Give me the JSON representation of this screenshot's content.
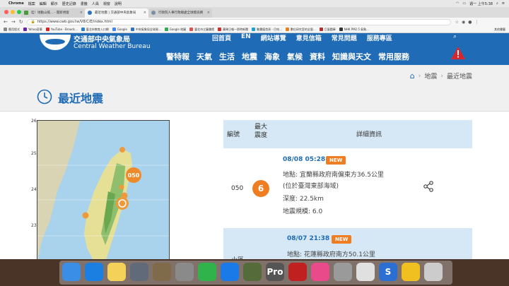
{
  "menubar": {
    "app": "Chrome",
    "menus": [
      "檔案",
      "編輯",
      "顯示",
      "歷史記錄",
      "書籤",
      "人員",
      "視窗",
      "說明"
    ],
    "clock": "週一 上午5:38"
  },
  "tabs": [
    {
      "label": "哇！地動山搖... - 開新視窗",
      "active": false,
      "color": "#4a9c3b"
    },
    {
      "label": "最近地震 | 交通部中央氣象局",
      "active": true,
      "color": "#2a74c2"
    },
    {
      "label": "行政院人事行政總處全球資訊網",
      "active": false,
      "color": "#7a8fa6"
    }
  ],
  "address": {
    "url": "https://www.cwb.gov.tw/V8/C/E/index.html"
  },
  "bookmarks": [
    {
      "label": "應用程式",
      "color": "#888888"
    },
    {
      "label": "Yahoo奇摩",
      "color": "#6a1fb0"
    },
    {
      "label": "YouTube - Broadc...",
      "color": "#e02020"
    },
    {
      "label": "臺北市教育入口網",
      "color": "#2a7fd1"
    },
    {
      "label": "Google",
      "color": "#4285f4"
    },
    {
      "label": "中央氣象局全球資...",
      "color": "#2a74c2"
    },
    {
      "label": "Google 地圖",
      "color": "#34a853"
    },
    {
      "label": "臺北市立圖書館",
      "color": "#d9534f"
    },
    {
      "label": "蘋果日報—即時新聞",
      "color": "#c9302c"
    },
    {
      "label": "動畫瘋首頁 - 巴哈...",
      "color": "#1ea1d9"
    },
    {
      "label": "數位研究室的全量...",
      "color": "#e67e22"
    },
    {
      "label": "巨蛋題庫",
      "color": "#b03030"
    },
    {
      "label": "NHK PM2.5 氣象...",
      "color": "#333333"
    }
  ],
  "bookmarks_other": "其他書籤",
  "header": {
    "site_name": "交通部中央氣象局",
    "site_name_en": "Central Weather Bureau",
    "top_links": [
      "回首頁",
      "EN",
      "網站導覽",
      "意見信箱",
      "常見問題",
      "服務專區"
    ],
    "nav": [
      "警特報",
      "天氣",
      "生活",
      "地震",
      "海象",
      "氣候",
      "資料",
      "知識與天文",
      "常用服務"
    ]
  },
  "breadcrumb": [
    "地震",
    "最近地震"
  ],
  "page_title": "最近地震",
  "map": {
    "lat_labels": [
      "26",
      "25",
      "24",
      "23"
    ],
    "marker_label": "050"
  },
  "table": {
    "headers": {
      "num": "編號",
      "mag": "最大\n震度",
      "detail": "詳細資訊"
    },
    "rows": [
      {
        "num": "050",
        "intensity": "6",
        "time": "08/08 05:28",
        "badge": "NEW",
        "location": "地點: 宜蘭縣政府南偏東方36.5公里",
        "location2": "(位於臺灣東部海域)",
        "depth": "深度: 22.5km",
        "magnitude": "地震規模: 6.0"
      },
      {
        "num": "小區",
        "time": "08/07 21:38",
        "badge": "NEW",
        "location": "地點: 花蓮縣政府南方50.1公里"
      }
    ]
  },
  "dock": {
    "apps": [
      {
        "name": "finder",
        "label": "",
        "color": "#3a8ee6"
      },
      {
        "name": "safari",
        "label": "",
        "color": "#1a7fe0"
      },
      {
        "name": "notes",
        "label": "",
        "color": "#f4d25a"
      },
      {
        "name": "launchpad",
        "label": "",
        "color": "#606a78"
      },
      {
        "name": "photo-editor",
        "label": "",
        "color": "#7f6a4a"
      },
      {
        "name": "system-prefs",
        "label": "",
        "color": "#8a8a8a"
      },
      {
        "name": "facetime",
        "label": "",
        "color": "#2fb34a"
      },
      {
        "name": "app-store",
        "label": "",
        "color": "#1a7ae8"
      },
      {
        "name": "messages-photo",
        "label": "",
        "color": "#566b3a"
      },
      {
        "name": "final-cut-pro",
        "label": "Pro",
        "color": "#555555"
      },
      {
        "name": "photo-booth",
        "label": "",
        "color": "#c02020"
      },
      {
        "name": "itunes",
        "label": "",
        "color": "#e84a8a"
      },
      {
        "name": "preview",
        "label": "",
        "color": "#9a9a9a"
      },
      {
        "name": "chrome",
        "label": "",
        "color": "#e0e0e0"
      },
      {
        "name": "sourcetree",
        "label": "S",
        "color": "#2a6fd1"
      },
      {
        "name": "photos",
        "label": "",
        "color": "#f0c020"
      },
      {
        "name": "trash",
        "label": "",
        "color": "#cccccc"
      }
    ]
  },
  "colors": {
    "brand": "#1f6bb5",
    "accent": "#ef7d22",
    "rowbg": "#d6e8f5"
  }
}
